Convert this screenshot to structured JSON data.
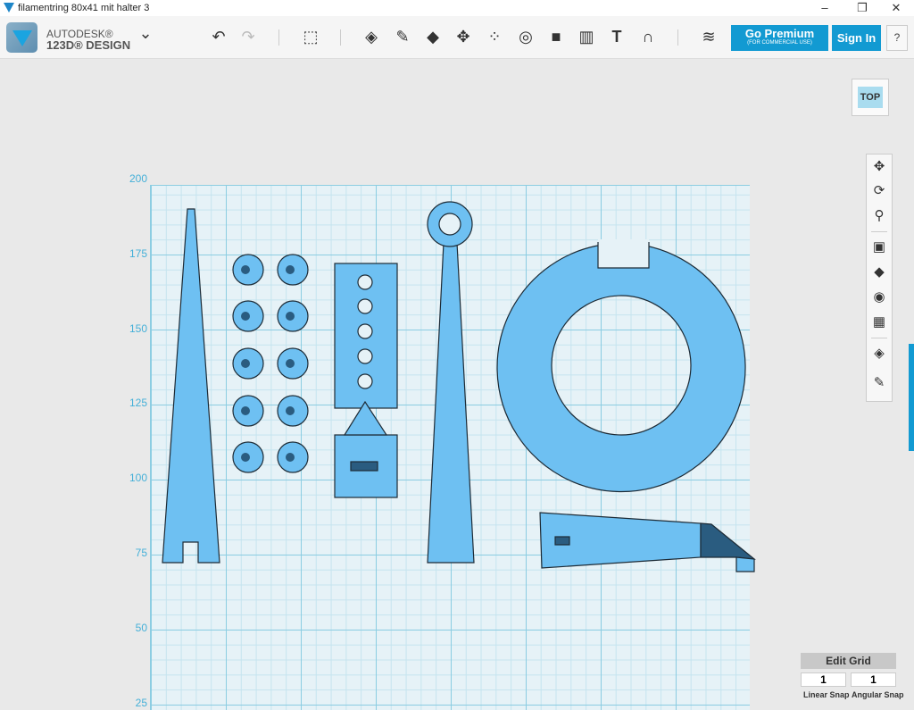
{
  "window": {
    "title": "filamentring 80x41 mit halter 3",
    "minimize": "–",
    "restore": "❐",
    "close": "✕"
  },
  "app": {
    "brand_top": "AUTODESK®",
    "brand_bottom": "123D® DESIGN",
    "menu_chevron": "⌄"
  },
  "toolbar": {
    "undo": "↶",
    "redo": "↷",
    "premium_label": "Go Premium",
    "premium_sub": "(FOR COMMERCIAL USE)",
    "signin_label": "Sign In",
    "help_label": "?",
    "text_tool": "T"
  },
  "viewcube": {
    "label": "TOP"
  },
  "grid": {
    "y_labels": [
      "200",
      "175",
      "150",
      "125",
      "100",
      "75",
      "50",
      "25"
    ]
  },
  "snap": {
    "edit_grid_label": "Edit Grid",
    "linear_value": "1",
    "angular_value": "1",
    "linear_label": "Linear Snap",
    "angular_label": "Angular Snap"
  },
  "colors": {
    "accent": "#129ad2",
    "part": "#6ec0f2",
    "edge": "#1d2b36"
  }
}
